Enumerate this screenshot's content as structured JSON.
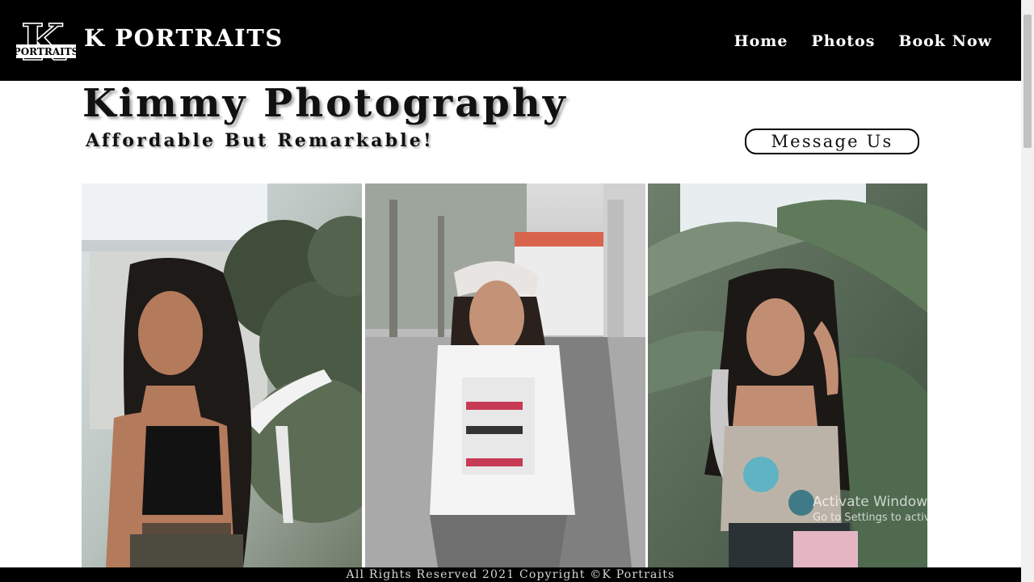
{
  "header": {
    "logo_text": "PORTRAITS",
    "brand": "K PORTRAITS",
    "nav": [
      {
        "label": "Home"
      },
      {
        "label": "Photos"
      },
      {
        "label": "Book Now"
      }
    ]
  },
  "hero": {
    "title": "Kimmy Photography",
    "subtitle": "Affordable But Remarkable!",
    "message_button": "Message Us"
  },
  "gallery": {
    "photos": [
      {
        "subject": "woman-black-top-garden"
      },
      {
        "subject": "woman-bandana-white-tshirt"
      },
      {
        "subject": "woman-floral-top-palms"
      }
    ]
  },
  "watermark": {
    "title": "Activate Windows",
    "subtitle": "Go to Settings to activate Windows."
  },
  "footer": {
    "copyright": "All Rights Reserved 2021 Copyright ©K Portraits"
  },
  "colors": {
    "navbar_bg": "#000000",
    "nav_text": "#ffffff",
    "page_bg": "#ffffff",
    "footer_bg": "#000000"
  }
}
